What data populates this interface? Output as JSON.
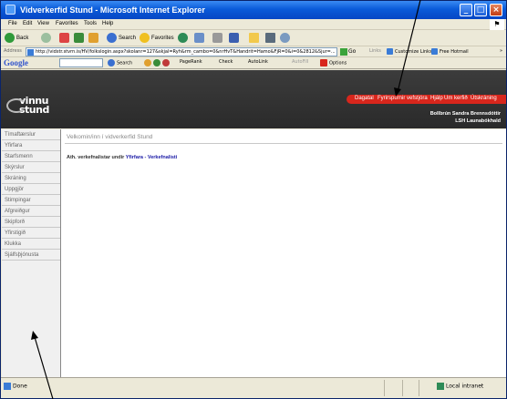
{
  "window": {
    "title": "Vidverkerfid Stund - Microsoft Internet Explorer"
  },
  "menubar": {
    "items": [
      "File",
      "Edit",
      "View",
      "Favorites",
      "Tools",
      "Help"
    ]
  },
  "toolbar": {
    "back_label": "Back",
    "search_label": "Search",
    "favorites_label": "Favorites"
  },
  "addressbar": {
    "label": "Address",
    "url": "http://vidstr.stvrn.is/HV/folkslogin.aspx?skolanr=127&skjal=Ryh&rm_cambo=0&nrHvT&Handrit=Hamo&FjR=0&i=0&2812&Sjur=...",
    "go_label": "Go",
    "links_label": "Links",
    "custom_links": "Customize Links",
    "free_hotmail": "Free Hotmail"
  },
  "googlebar": {
    "logo": "Google",
    "search_label": "Search",
    "pagerank_label": "PageRank",
    "check_label": "Check",
    "autolink_label": "AutoLink",
    "autofill_label": "AutoFill",
    "options_label": "Options"
  },
  "site": {
    "logo_line1": "vinnu",
    "logo_line2": "stund",
    "topnav": [
      "Dagatal",
      "Fyrirspurnir vefstjóra",
      "Hjálp",
      "Um kerfið",
      "Útskráning"
    ],
    "user_name": "Bollbrún Sandra Brennsdóttir",
    "school_name": "LSH Launabókhald"
  },
  "sidebar": {
    "items": [
      "Tímaftærslur",
      "Yfirfara",
      "Starfsmenn",
      "Skýrslur",
      "Skráning",
      "Uppgjör",
      "Stimpingar",
      "Afgreiðgur",
      "Skipforð",
      "Yfirstigið",
      "Klukka",
      "Sjálfsþjónusta"
    ]
  },
  "main": {
    "welcome": "Velkomin/inn í vidverkerfid Stund",
    "notice_prefix": "Ath. verkefnalistar undir",
    "notice_link": "Yfirfara - Verkefnalisti"
  },
  "statusbar": {
    "status": "Done",
    "zone": "Local intranet"
  }
}
